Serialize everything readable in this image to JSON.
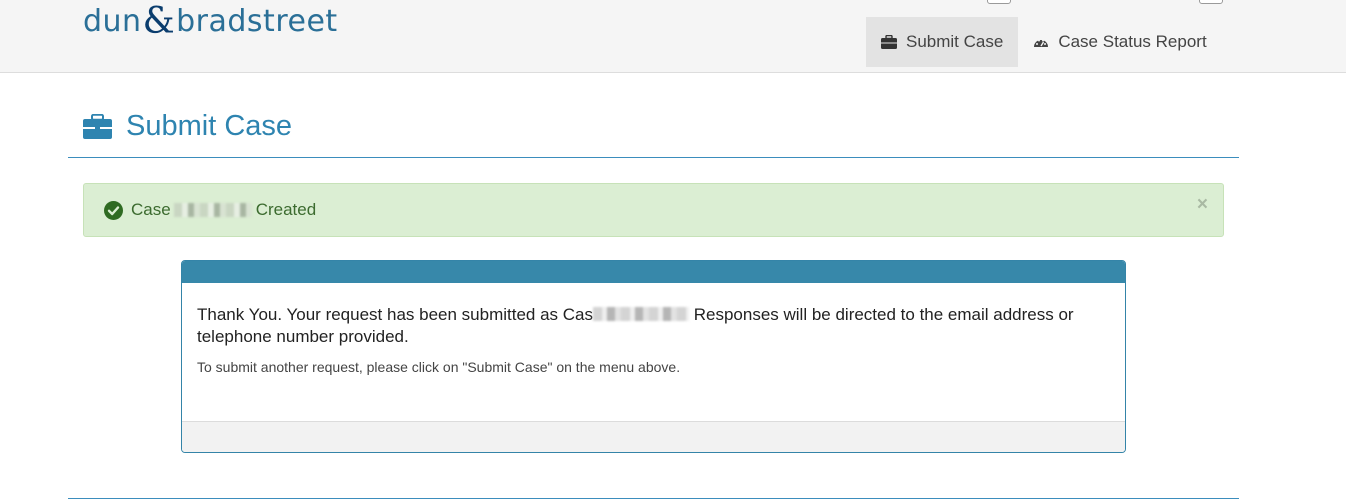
{
  "header": {
    "logo_left": "dun",
    "logo_amp": "&",
    "logo_right": "bradstreet"
  },
  "nav": {
    "items": [
      {
        "label": "Submit Case",
        "icon": "briefcase-icon",
        "active": true
      },
      {
        "label": "Case Status Report",
        "icon": "dashboard-icon",
        "active": false
      }
    ]
  },
  "page": {
    "title": "Submit Case",
    "title_icon": "briefcase-icon"
  },
  "alert": {
    "prefix": "Case",
    "suffix": "Created",
    "close": "×",
    "color": "#dbeed3"
  },
  "panel": {
    "message_before": "Thank You.  Your request has been submitted as Cas",
    "message_after": " Responses will be directed to the email address or telephone number provided.",
    "sub": "To submit another request, please click on \"Submit Case\" on the menu above.",
    "header_color": "#3788aa"
  }
}
